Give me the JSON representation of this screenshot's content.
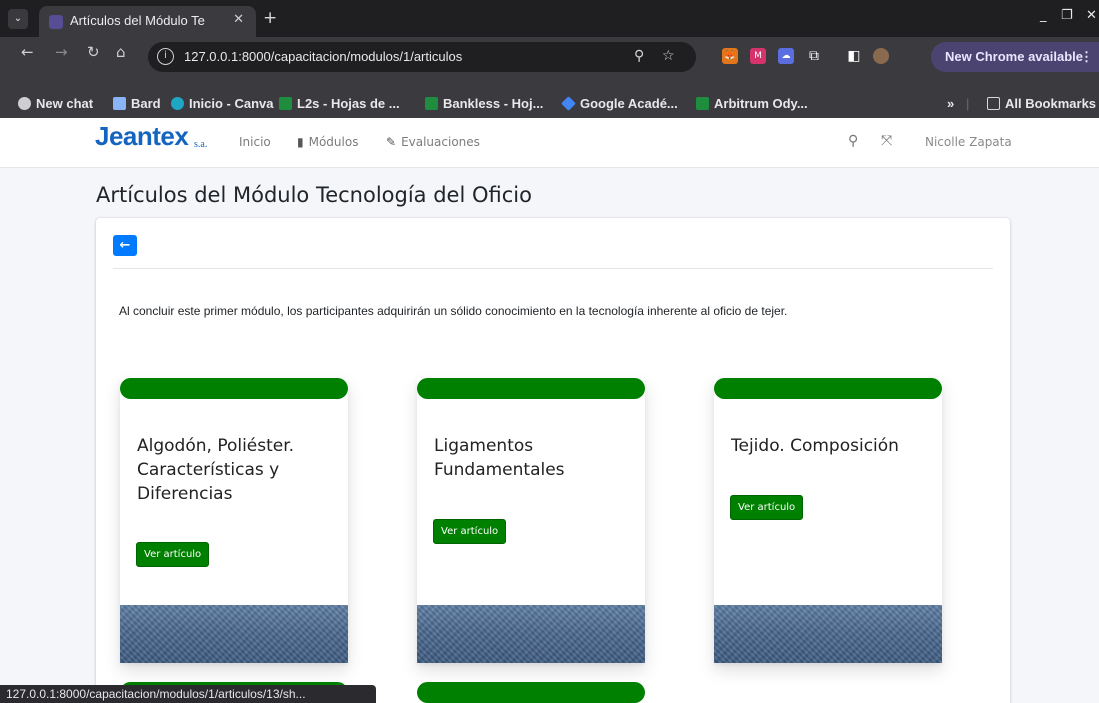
{
  "browser": {
    "tab_title": "Artículos del Módulo Te",
    "url": "127.0.0.1:8000/capacitacion/modulos/1/articulos",
    "update_label": "New Chrome available",
    "bookmarks": [
      {
        "label": "New chat",
        "icon": "openai-icon",
        "color": "#cfcfd3"
      },
      {
        "label": "Bard",
        "icon": "sparkle-icon",
        "color": "#8ab4f8"
      },
      {
        "label": "Inicio - Canva",
        "icon": "canva-icon",
        "color": "#1ea7c4"
      },
      {
        "label": "L2s - Hojas de ...",
        "icon": "sheets-icon",
        "color": "#1e8e3e"
      },
      {
        "label": "Bankless - Hoj...",
        "icon": "sheets-icon",
        "color": "#1e8e3e"
      },
      {
        "label": "Google Acadé...",
        "icon": "scholar-icon",
        "color": "#4285f4"
      },
      {
        "label": "Arbitrum Ody...",
        "icon": "sheets-icon",
        "color": "#1e8e3e"
      }
    ],
    "overflow_label": "»",
    "all_bookmarks": "All Bookmarks",
    "status_url": "127.0.0.1:8000/capacitacion/modulos/1/articulos/13/sh..."
  },
  "app": {
    "brand": "Jeantex",
    "brand_suffix": "s.a.",
    "nav": [
      {
        "label": "Inicio",
        "icon": ""
      },
      {
        "label": "Módulos",
        "icon": "file-icon"
      },
      {
        "label": "Evaluaciones",
        "icon": "pencil-icon"
      }
    ],
    "user_name": "Nicolle Zapata"
  },
  "page": {
    "title": "Artículos del Módulo Tecnología del Oficio",
    "description": "Al concluir este primer módulo, los participantes adquirirán un sólido conocimiento en la tecnología inherente al oficio de tejer.",
    "accent_color": "#008000",
    "back_color": "#007bff",
    "articles": [
      {
        "title": "Algodón, Poliéster. Características y Diferencias",
        "button": "Ver artículo"
      },
      {
        "title": "Ligamentos Fundamentales",
        "button": "Ver artículo"
      },
      {
        "title": "Tejido. Composición",
        "button": "Ver artículo"
      }
    ]
  }
}
